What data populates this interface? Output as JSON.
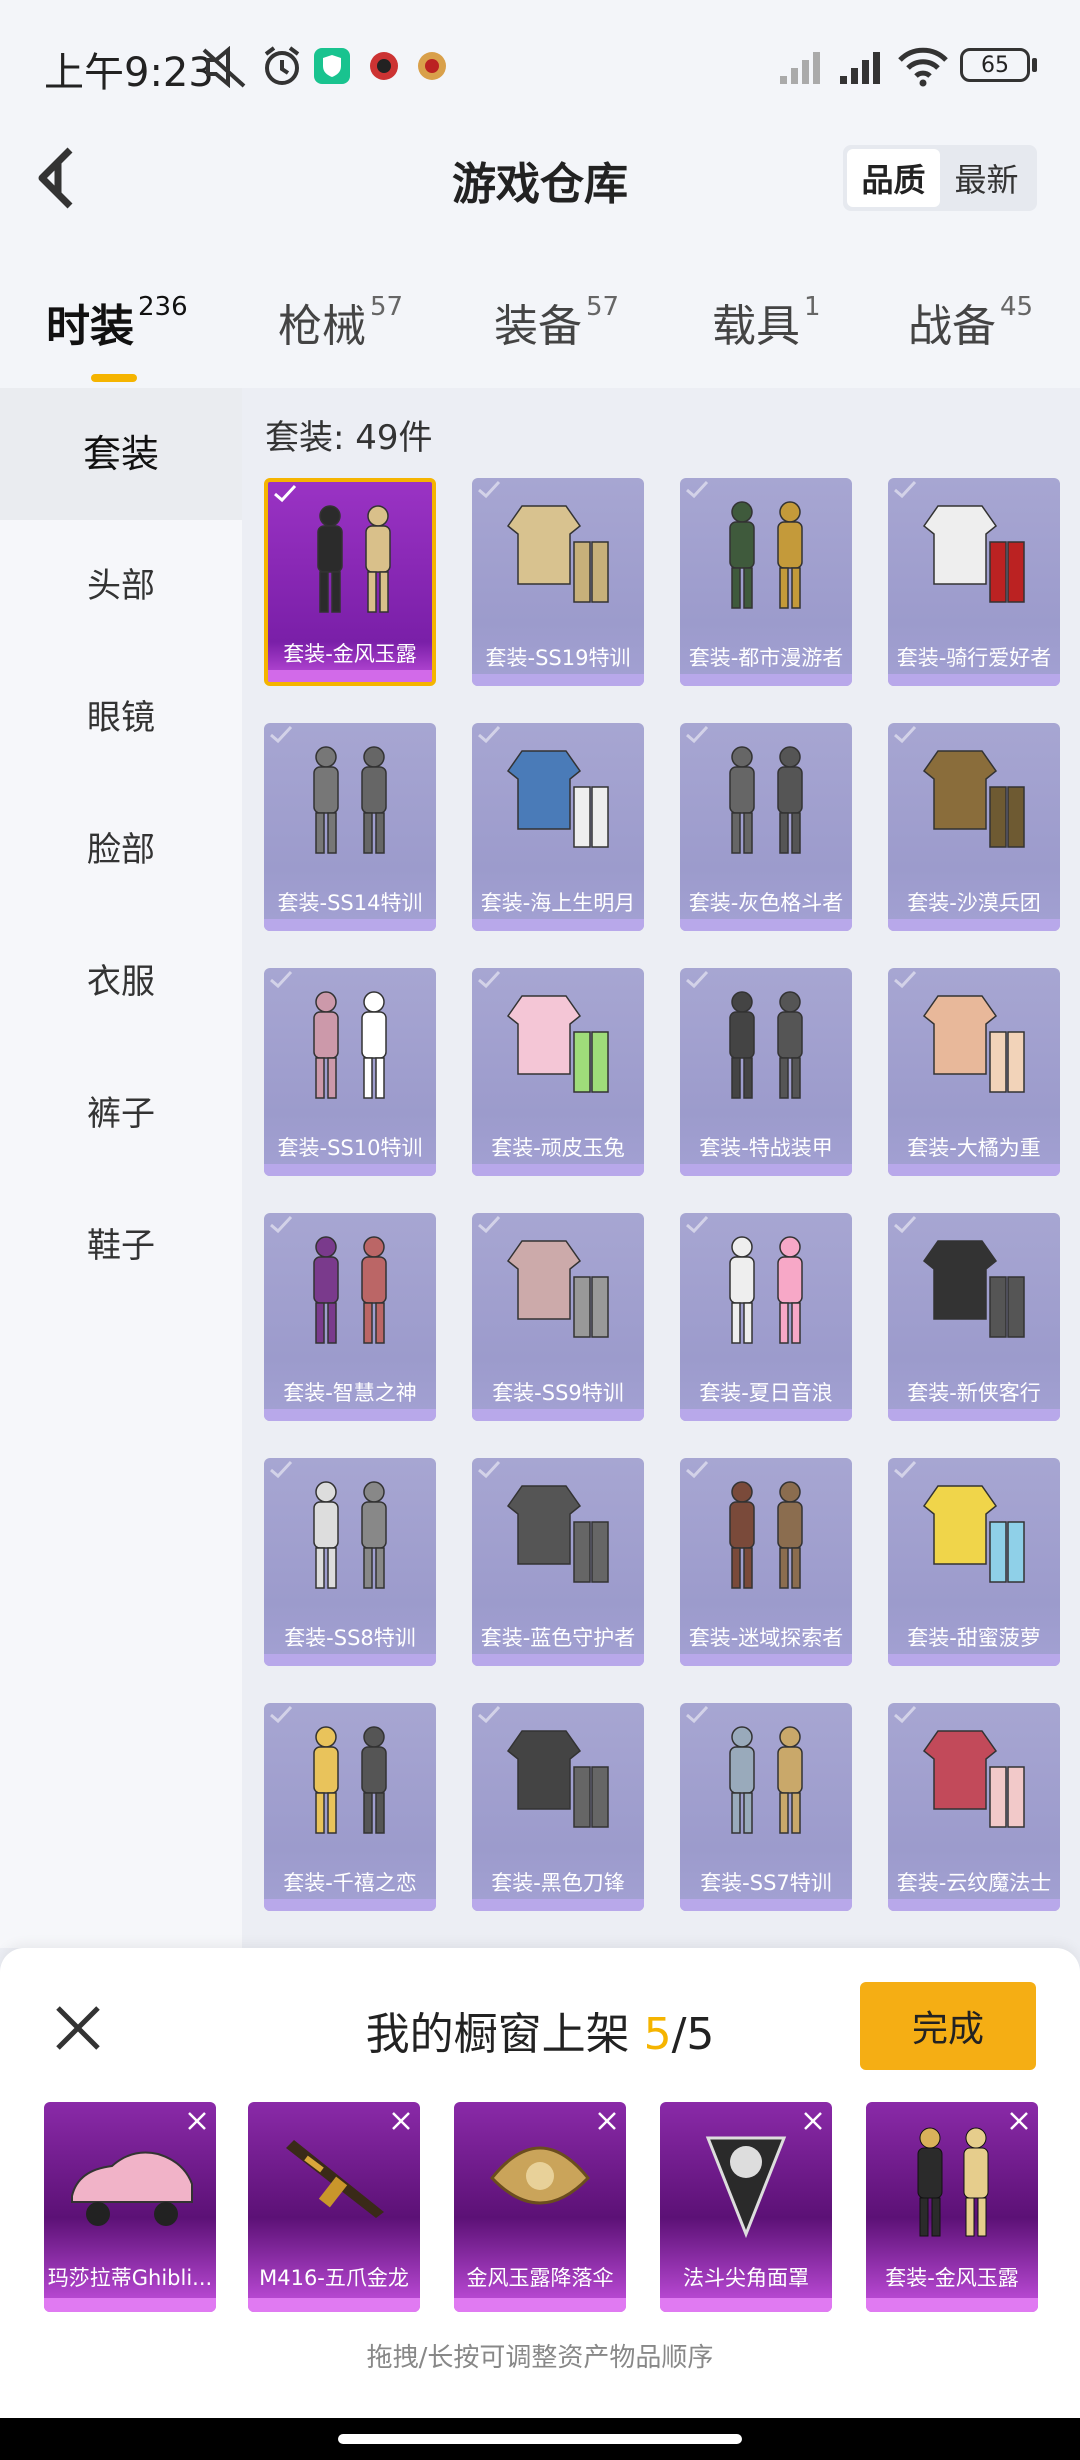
{
  "status_bar": {
    "time": "上午9:23",
    "battery": "65"
  },
  "header": {
    "title": "游戏仓库",
    "sort_options": [
      "品质",
      "最新"
    ],
    "sort_selected": "品质"
  },
  "tabs": [
    {
      "label": "时装",
      "count": "236",
      "active": true
    },
    {
      "label": "枪械",
      "count": "57"
    },
    {
      "label": "装备",
      "count": "57"
    },
    {
      "label": "载具",
      "count": "1"
    },
    {
      "label": "战备",
      "count": "45"
    }
  ],
  "sidebar": {
    "items": [
      "套装",
      "头部",
      "眼镜",
      "脸部",
      "衣服",
      "裤子",
      "鞋子"
    ],
    "selected": "套装"
  },
  "grid": {
    "count_label": "套装: 49件",
    "items": [
      "套装-金风玉露",
      "套装-SS19特训",
      "套装-都市漫游者",
      "套装-骑行爱好者",
      "套装-SS14特训",
      "套装-海上生明月",
      "套装-灰色格斗者",
      "套装-沙漠兵团",
      "套装-SS10特训",
      "套装-顽皮玉兔",
      "套装-特战装甲",
      "套装-大橘为重",
      "套装-智慧之神",
      "套装-SS9特训",
      "套装-夏日音浪",
      "套装-新侠客行",
      "套装-SS8特训",
      "套装-蓝色守护者",
      "套装-迷域探索者",
      "套装-甜蜜菠萝",
      "套装-千禧之恋",
      "套装-黑色刀锋",
      "套装-SS7特训",
      "套装-云纹魔法士"
    ]
  },
  "showcase": {
    "title_prefix": "我的橱窗上架 ",
    "current": "5",
    "separator": "/",
    "total": "5",
    "done_label": "完成",
    "items": [
      "玛莎拉蒂Ghibli...",
      "M416-五爪金龙",
      "金风玉露降落伞",
      "法斗尖角面罩",
      "套装-金风玉露"
    ],
    "hint": "拖拽/长按可调整资产物品顺序"
  }
}
